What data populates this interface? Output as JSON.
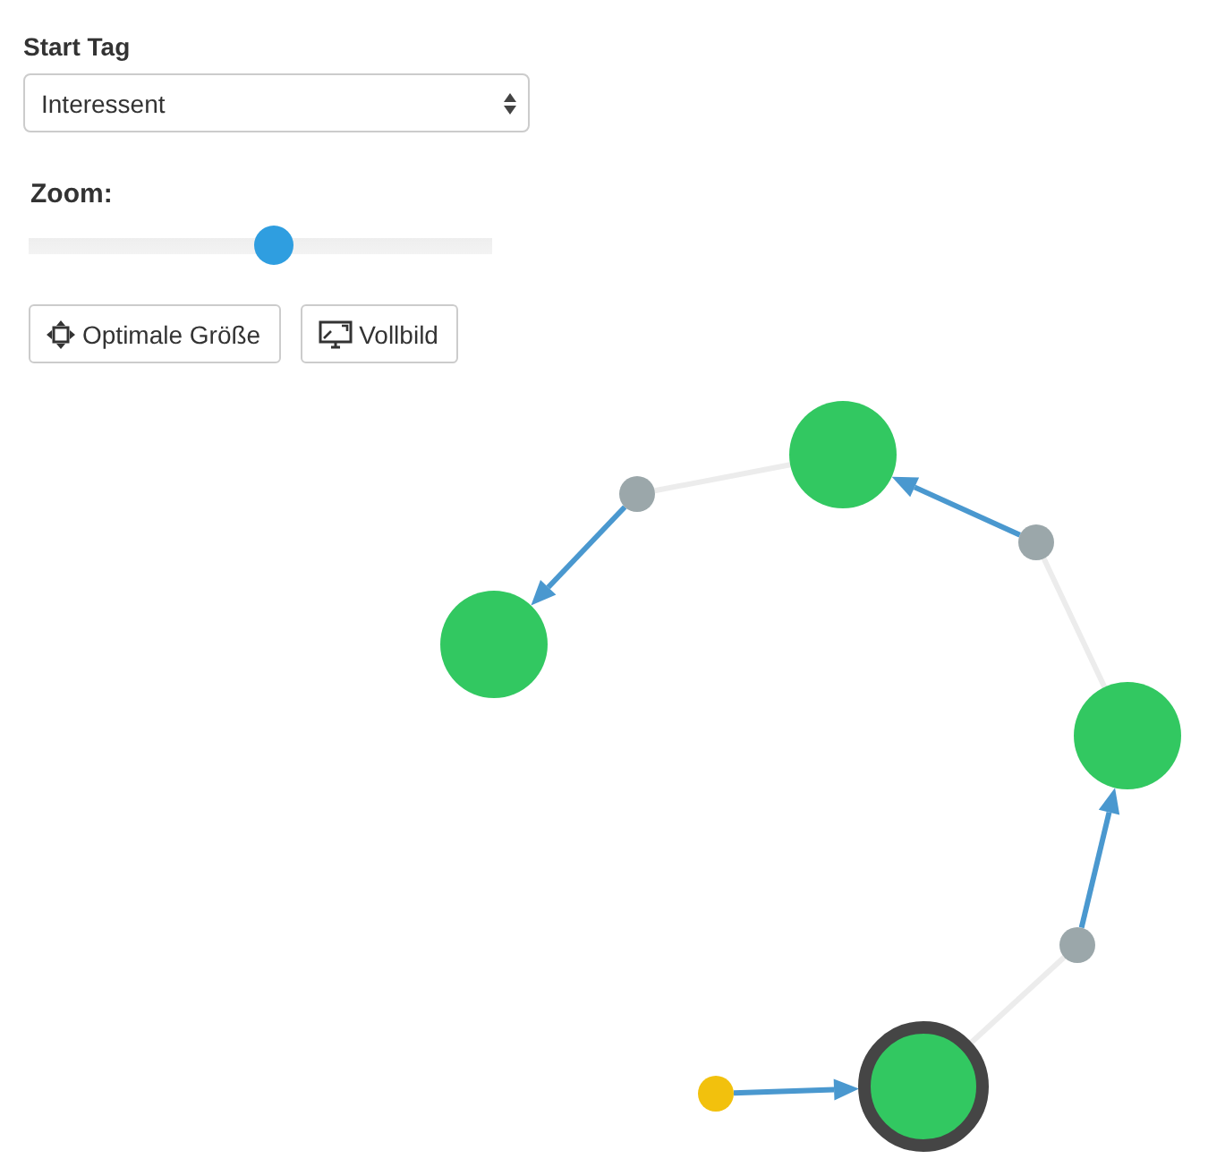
{
  "start_tag": {
    "label": "Start Tag",
    "value": "Interessent"
  },
  "zoom": {
    "label": "Zoom:",
    "level": 0.53
  },
  "buttons": [
    {
      "kind": "fit",
      "label": "Optimale Größe"
    },
    {
      "kind": "fullscreen",
      "label": "Vollbild"
    }
  ],
  "graph": {
    "nodes": [
      {
        "kind": "topic",
        "selected": false
      },
      {
        "kind": "topic",
        "selected": false
      },
      {
        "kind": "topic",
        "selected": false
      },
      {
        "kind": "topic",
        "selected": true
      },
      {
        "kind": "link",
        "selected": false
      },
      {
        "kind": "link",
        "selected": false
      },
      {
        "kind": "link",
        "selected": false
      },
      {
        "kind": "start",
        "selected": false
      }
    ]
  }
}
